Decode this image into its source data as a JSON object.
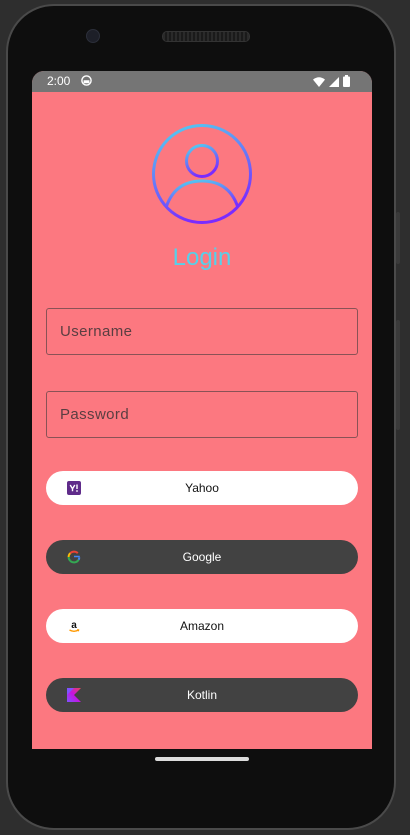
{
  "status_bar": {
    "time": "2:00",
    "app_icon": "android-debug-icon",
    "indicators": [
      "wifi-icon",
      "cellular-signal-icon",
      "battery-icon"
    ]
  },
  "login": {
    "avatar_icon": "user-account-icon",
    "title": "Login",
    "username_placeholder": "Username",
    "username_value": "",
    "password_placeholder": "Password",
    "password_value": ""
  },
  "buttons": [
    {
      "label": "Yahoo",
      "icon": "yahoo-logo-icon",
      "style": "light"
    },
    {
      "label": "Google",
      "icon": "google-logo-icon",
      "style": "dark"
    },
    {
      "label": "Amazon",
      "icon": "amazon-logo-icon",
      "style": "light"
    },
    {
      "label": "Kotlin",
      "icon": "kotlin-logo-icon",
      "style": "dark"
    }
  ],
  "colors": {
    "background": "#fc7880",
    "title": "#56d0ea",
    "avatar_gradient_start": "#4fd6f0",
    "avatar_gradient_end": "#7a2bff",
    "dark_button": "#424242",
    "light_button": "#ffffff"
  }
}
